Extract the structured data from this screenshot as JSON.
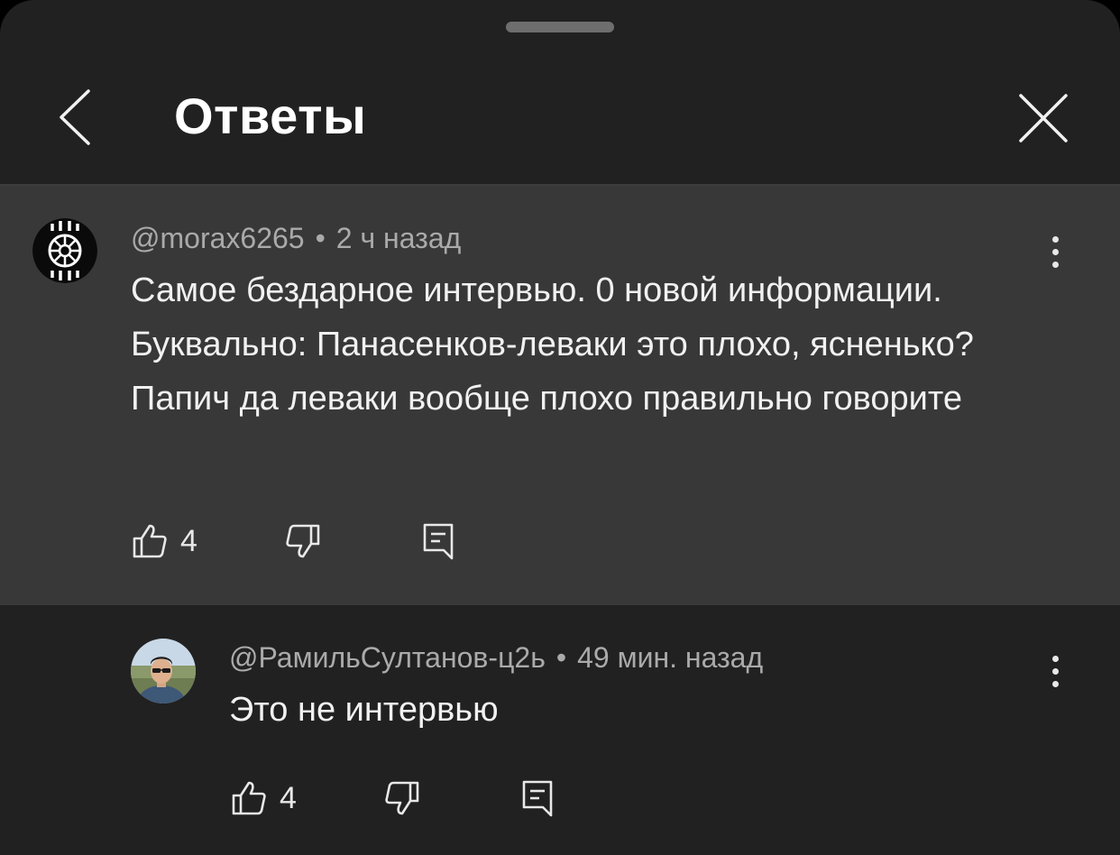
{
  "header": {
    "title": "Ответы",
    "back_icon": "chevron-left-icon",
    "close_icon": "close-icon"
  },
  "comments": [
    {
      "author": "@morax6265",
      "time": "2 ч назад",
      "text": "Самое бездарное интервью. 0 новой информации. Буквально: Панасенков-леваки это плохо, ясненько? Папич да леваки вообще плохо правильно говорите",
      "likes": "4"
    },
    {
      "author": "@РамильСултанов-ц2ь",
      "time": "49 мин. назад",
      "text": "Это не интервью",
      "likes": "4"
    }
  ],
  "separator": "•",
  "colors": {
    "sheet_bg": "#212121",
    "highlight_bg": "#383838",
    "text_primary": "#f1f1f1",
    "text_secondary": "#aaaaaa"
  }
}
